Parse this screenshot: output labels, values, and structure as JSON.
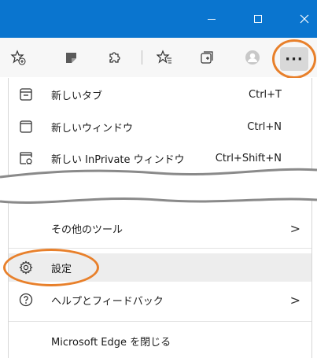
{
  "colors": {
    "titlebar": "#0a75cf",
    "accent_ring": "#e8802b",
    "hover": "#ededed"
  },
  "toolbar": {
    "icons": [
      "add-favorite-icon",
      "collections-color-icon",
      "extensions-icon",
      "favorites-icon",
      "collections-icon",
      "profile-icon"
    ],
    "more_label": "···"
  },
  "menu": {
    "new_tab": {
      "label": "新しいタブ",
      "shortcut": "Ctrl+T"
    },
    "new_window": {
      "label": "新しいウィンドウ",
      "shortcut": "Ctrl+N"
    },
    "new_inprivate": {
      "label": "新しい InPrivate ウィンドウ",
      "shortcut": "Ctrl+Shift+N"
    },
    "more_tools": {
      "label": "その他のツール",
      "arrow": ">"
    },
    "settings": {
      "label": "設定"
    },
    "help": {
      "label": "ヘルプとフィードバック",
      "arrow": ">"
    },
    "close_edge": {
      "label": "Microsoft Edge を閉じる"
    }
  }
}
